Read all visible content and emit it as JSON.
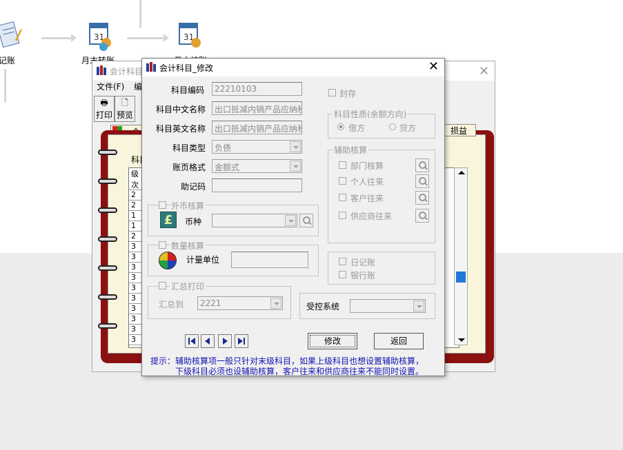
{
  "flow": {
    "node1_label": "记账",
    "node2_label": "月末转账",
    "node3_label": "月末结账",
    "calendar_day": "31"
  },
  "bg_window": {
    "title": "会计科目",
    "menu": [
      "文件(F)",
      "编"
    ],
    "toolbar": {
      "print": "打印",
      "preview": "预览"
    },
    "tab_all": "全",
    "tab_loss": "损益",
    "subject_label": "科目",
    "levels_header": "级次",
    "levels": [
      "2",
      "2",
      "1",
      "1",
      "2",
      "3",
      "3",
      "3",
      "3",
      "3",
      "3",
      "3",
      "3",
      "3",
      "3"
    ]
  },
  "dialog": {
    "title": "会计科目_修改",
    "code_label": "科目编码",
    "code_value": "22210103",
    "cn_name_label": "科目中文名称",
    "cn_name_value": "出口抵减内销产品应纳税",
    "en_name_label": "科目英文名称",
    "en_name_value": "出口抵减内销产品应纳税",
    "type_label": "科目类型",
    "type_value": "负债",
    "format_label": "账页格式",
    "format_value": "金额式",
    "mnemonic_label": "助记码",
    "mnemonic_value": "",
    "seal_label": "封存",
    "nature_group": "科目性质(余额方向)",
    "debit": "借方",
    "credit": "贷方",
    "aux_group": "辅助核算",
    "aux_items": [
      "部门核算",
      "个人往来",
      "客户往来",
      "供应商往来"
    ],
    "fx_group": "外币核算",
    "currency_label": "币种",
    "currency_icon_glyph": "£",
    "qty_group": "数量核算",
    "unit_label": "计量单位",
    "summary_group": "汇总打印",
    "summary_to_label": "汇总到",
    "summary_to_value": "2221",
    "journal": "日记账",
    "bank_journal": "银行账",
    "controlled_label": "受控系统",
    "controlled_value": "",
    "modify_button": "修改",
    "back_button": "返回",
    "hint_line1": "提示：辅助核算项一般只针对末级科目，如果上级科目也想设置辅助核算，",
    "hint_line2": "下级科目必须也设辅助核算，客户往来和供应商往来不能同时设置。"
  },
  "colors": {
    "notebook": "#8b1010",
    "hint_text": "#1212b4",
    "disabled_text": "#9a9a9a"
  }
}
